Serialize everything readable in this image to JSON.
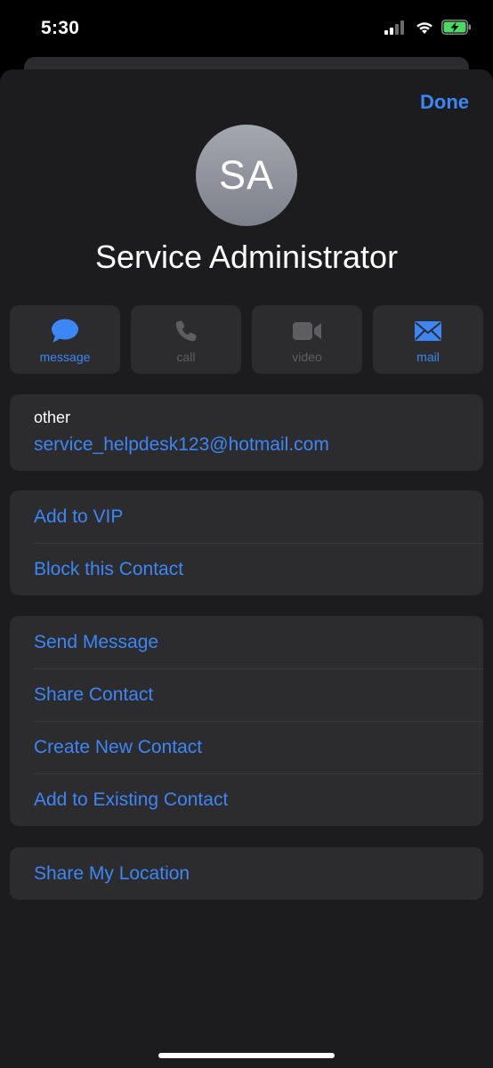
{
  "status_bar": {
    "time": "5:30",
    "icons": [
      "cellular-signal-icon",
      "wifi-icon",
      "battery-charging-icon"
    ]
  },
  "header": {
    "done_label": "Done"
  },
  "contact": {
    "initials": "SA",
    "name": "Service Administrator"
  },
  "actions": [
    {
      "label": "message",
      "icon": "message-bubble-icon",
      "enabled": true
    },
    {
      "label": "call",
      "icon": "phone-icon",
      "enabled": false
    },
    {
      "label": "video",
      "icon": "video-camera-icon",
      "enabled": false
    },
    {
      "label": "mail",
      "icon": "envelope-icon",
      "enabled": true
    }
  ],
  "email": {
    "label": "other",
    "value": "service_helpdesk123@hotmail.com"
  },
  "group_vip": [
    "Add to VIP",
    "Block this Contact"
  ],
  "group_actions": [
    "Send Message",
    "Share Contact",
    "Create New Contact",
    "Add to Existing Contact"
  ],
  "group_location": [
    "Share My Location"
  ],
  "colors": {
    "accent": "#3d86f5",
    "sheet_background": "#1c1c1e",
    "cell_background": "#2c2c2e",
    "disabled": "#5d5d62"
  }
}
